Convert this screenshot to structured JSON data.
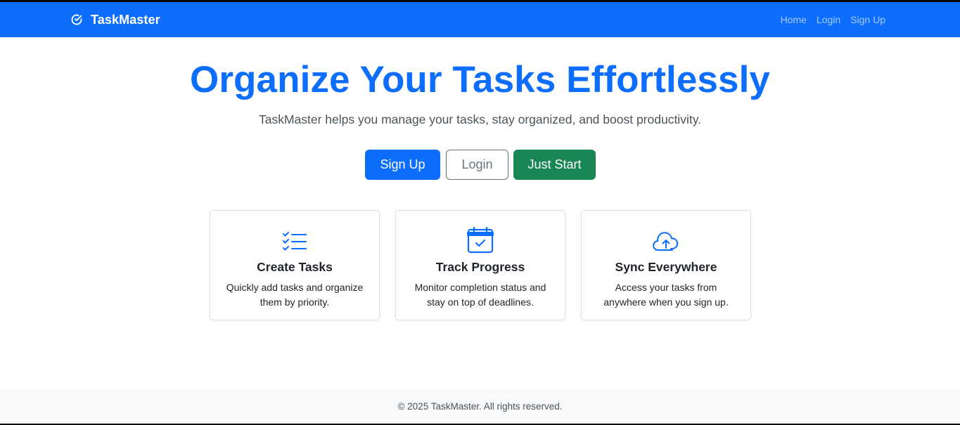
{
  "navbar": {
    "brand": "TaskMaster",
    "brand_icon": "check-circle-icon",
    "links": [
      "Home",
      "Login",
      "Sign Up"
    ]
  },
  "hero": {
    "title": "Organize Your Tasks Effortlessly",
    "subtitle": "TaskMaster helps you manage your tasks, stay organized, and boost productivity."
  },
  "buttons": {
    "signup": "Sign Up",
    "login": "Login",
    "just_start": "Just Start"
  },
  "features": [
    {
      "icon": "task-list-icon",
      "title": "Create Tasks",
      "text": "Quickly add tasks and organize them by priority."
    },
    {
      "icon": "calendar-check-icon",
      "title": "Track Progress",
      "text": "Monitor completion status and stay on top of deadlines."
    },
    {
      "icon": "cloud-upload-icon",
      "title": "Sync Everywhere",
      "text": "Access your tasks from anywhere when you sign up."
    }
  ],
  "footer": {
    "text": "© 2025 TaskMaster. All rights reserved."
  },
  "colors": {
    "primary": "#0d6efd",
    "success": "#198754",
    "secondary": "#6c757d",
    "footer_bg": "#f8f9fa"
  }
}
